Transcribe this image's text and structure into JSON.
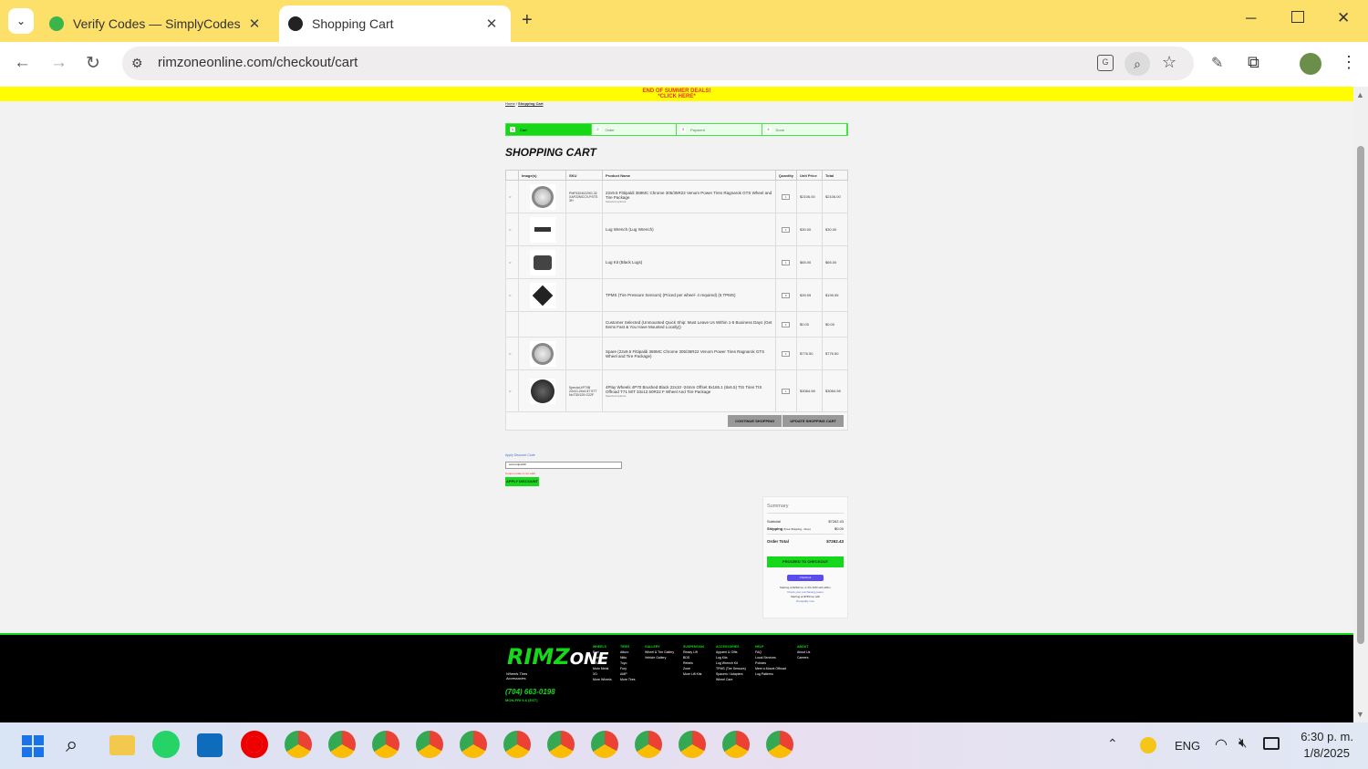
{
  "browser": {
    "tabs": [
      {
        "title": "Verify Codes — SimplyCodes",
        "active": false
      },
      {
        "title": "Shopping Cart",
        "active": true
      }
    ],
    "url": "rimzoneonline.com/checkout/cart"
  },
  "banner": {
    "line1": "END OF SUMMER DEALS!",
    "line2": "*CLICK HERE*"
  },
  "breadcrumb": {
    "home": "Home",
    "current": "Shopping Cart"
  },
  "steps": [
    {
      "num": "1",
      "label": "Cart"
    },
    {
      "num": "2",
      "label": "Order"
    },
    {
      "num": "3",
      "label": "Payment"
    },
    {
      "num": "4",
      "label": "Done"
    }
  ],
  "cart_title": "SHOPPING CART",
  "cart_headers": [
    "Image(s)",
    "SKU",
    "Product Name",
    "Quantity",
    "Unit Price",
    "Total"
  ],
  "cart_items": [
    {
      "sku": "PMF53240229G-32XAP22MCCV-PSTS3H",
      "name": "22x9.5 Fittipaldi 369MC Chrome 305/35R22 Venom Power Tires Ragnarok GTS Wheel and Tire Package",
      "option": "Selected options:",
      "qty": "1",
      "unit": "$2106.00",
      "total": "$2106.00"
    },
    {
      "sku": "",
      "name": "Lug Wrench (Lug Wrench)",
      "option": "",
      "qty": "1",
      "unit": "$30.00",
      "total": "$30.00"
    },
    {
      "sku": "",
      "name": "Lug Kit (Black Lugs)",
      "option": "",
      "qty": "1",
      "unit": "$65.00",
      "total": "$65.00"
    },
    {
      "sku": "",
      "name": "TPMS (Tire Pressure Sensors) (Priced per wheel- 4 required) (5 TPMS)",
      "option": "",
      "qty": "5",
      "unit": "$39.99",
      "total": "$199.95"
    },
    {
      "sku": "",
      "name": "Customer Selected (Unmounted Quick Ship: Must Leave Us Within 1-5 Business Days (Get Items Fast & You Have Mounted Locally))",
      "option": "",
      "qty": "1",
      "unit": "$0.00",
      "total": "$0.00"
    },
    {
      "sku": "",
      "name": "Spare (22x9.5 Fittipaldi 369MC Chrome 305/35R22 Venom Power Tires Ragnarok GTS Wheel and Tire Package)",
      "option": "",
      "qty": "1",
      "unit": "$776.50",
      "total": "$776.50"
    },
    {
      "sku": "Special-4P70B 22x10-24x4.5T 5T7 NoT33/125 G22F",
      "name": "4Play Wheels 4P70 Brushed Black 22x10 -24mm Offset 8x165.1 (8x6.5) TIS Tires TIS Offroad T71 M/T 33x12.50R22 F Wheel And Tire Package",
      "option": "Selected options:",
      "qty": "1",
      "unit": "$3084.98",
      "total": "$3084.98"
    }
  ],
  "buttons": {
    "continue": "CONTINUE SHOPPING",
    "update": "UPDATE SHOPPING CART"
  },
  "discount": {
    "link": "Apply Discount Code",
    "placeholder": "www.arijeet99",
    "error": "Coupon code is not valid",
    "apply": "APPLY DISCOUNT"
  },
  "summary": {
    "title": "Summary",
    "subtotal_label": "Subtotal",
    "subtotal": "$7262.43",
    "shipping_label": "Shipping",
    "shipping_note": "(Free Shipping - Free)",
    "shipping": "$0.00",
    "total_label": "Order Total",
    "total": "$7262.43",
    "checkout": "PROCEED TO CHECKOUT",
    "alt_pay": "Checkout",
    "affirm1": "Starting at $262/mo or 0% APR with affirm",
    "affirm2": "Check your purchasing power",
    "affirm3": "Starting at $766/mo with",
    "affirm4": "Prequalify now"
  },
  "footer": {
    "logo1": "RIMZ",
    "logo2": "ONE",
    "logo_tag": "Wheels Tires Accessories",
    "phone": "(704) 663-0198",
    "hours": "MON-FRI 9-6 (EST)",
    "cols": [
      {
        "h": "WHEELS",
        "items": [
          "Fuel",
          "Hostile",
          "TIS",
          "Moto Metal",
          "XD",
          "More Wheels"
        ]
      },
      {
        "h": "TIRES",
        "items": [
          "Atturo",
          "Nitto",
          "Toyo",
          "Fury",
          "AMP",
          "More Tires"
        ]
      },
      {
        "h": "GALLERY",
        "items": [
          "Wheel & Tire Gallery",
          "Vehicle Gallery"
        ]
      },
      {
        "h": "SUSPENSION",
        "items": [
          "Ready Lift",
          "BDS",
          "Rebels",
          "Zone",
          "More Lift Kits"
        ]
      },
      {
        "h": "ACCESSORIES",
        "items": [
          "Apparel & Gifts",
          "Lug Kits",
          "Lug Wrench Kit",
          "TPMS (Tire Sensors)",
          "Spacers / Adapters",
          "Wheel Care"
        ]
      },
      {
        "h": "HELP",
        "items": [
          "FAQ",
          "Local Services",
          "Policies",
          "Meet a Mount Offroad",
          "Lug Patterns"
        ]
      },
      {
        "h": "ABOUT",
        "items": [
          "About Us",
          "Careers"
        ]
      }
    ]
  },
  "taskbar": {
    "lang": "ENG",
    "time": "6:30 p. m.",
    "date": "1/8/2025"
  },
  "colors": {
    "accent": "#16d81a",
    "banner": "#fffd00",
    "tabbar": "#fde06a"
  }
}
